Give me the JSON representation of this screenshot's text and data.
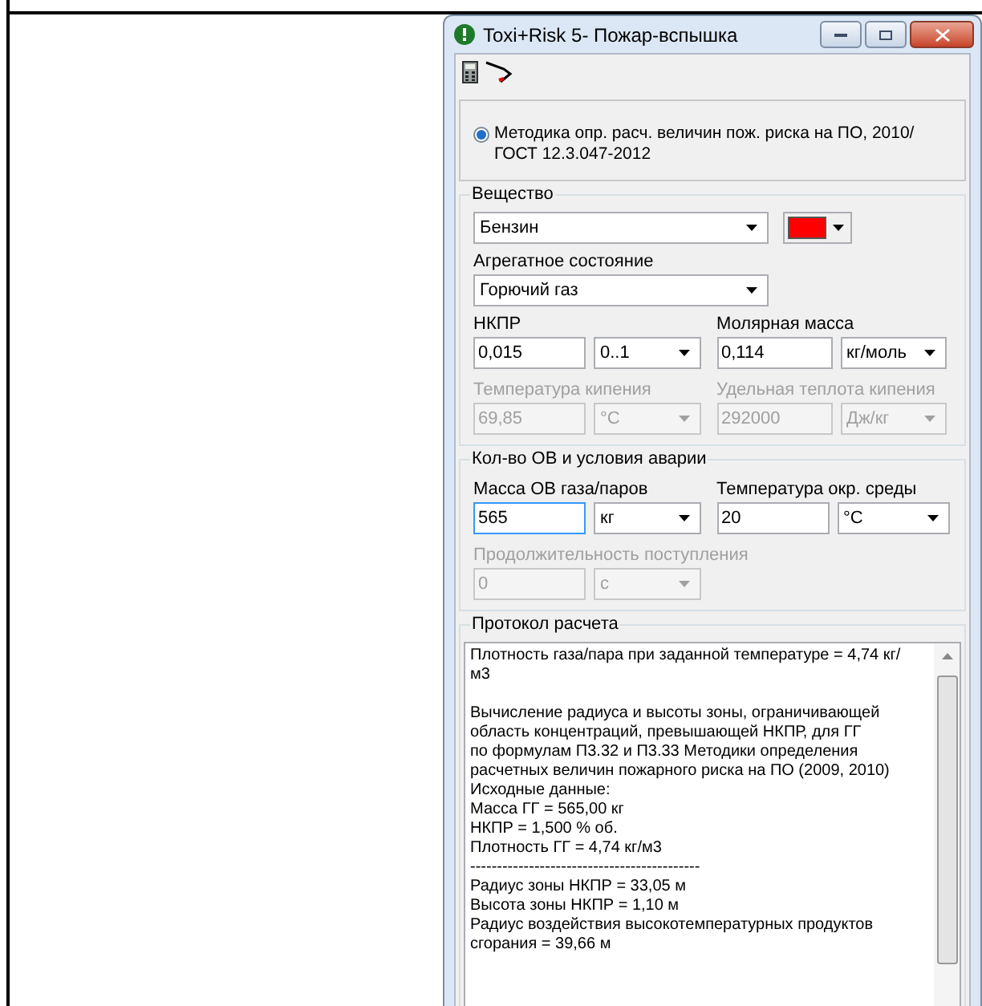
{
  "window": {
    "title": "Toxi+Risk 5- Пожар-вспышка"
  },
  "method": {
    "label": "Методика опр. расч. величин пож. риска на ПО, 2010/ ГОСТ 12.3.047-2012",
    "selected": true
  },
  "substance": {
    "title": "Вещество",
    "name": "Бензин",
    "color": "#ff0000",
    "state_label": "Агрегатное состояние",
    "state": "Горючий газ",
    "fields": [
      {
        "label": "НКПР",
        "value": "0,015",
        "unit": "0..1",
        "disabled": false
      },
      {
        "label": "Молярная масса",
        "value": "0,114",
        "unit": "кг/моль",
        "disabled": false
      },
      {
        "label": "Температура кипения",
        "value": "69,85",
        "unit": "°C",
        "disabled": true
      },
      {
        "label": "Удельная теплота кипения",
        "value": "292000",
        "unit": "Дж/кг",
        "disabled": true
      }
    ]
  },
  "accident": {
    "title": "Кол-во ОВ и условия аварии",
    "fields": [
      {
        "label": "Масса ОВ газа/паров",
        "value": "565",
        "unit": "кг",
        "disabled": false
      },
      {
        "label": "Температура окр. среды",
        "value": "20",
        "unit": "°C",
        "disabled": false
      },
      {
        "label": "Продолжительность поступления",
        "value": "0",
        "unit": "с",
        "disabled": true
      }
    ]
  },
  "protocol": {
    "title": "Протокол расчета",
    "blocks": [
      [
        "Плотность газа/пара при заданной температуре = 4,74 кг/м3"
      ],
      [
        "Вычисление радиуса и высоты зоны, ограничивающей",
        "область концентраций, превышающей НКПР, для ГГ",
        "по формулам П3.32 и П3.33 Методики определения",
        "расчетных величин пожарного риска на ПО (2009, 2010)",
        "Исходные данные:",
        "Масса ГГ = 565,00 кг",
        "НКПР = 1,500 % об.",
        "Плотность ГГ = 4,74 кг/м3",
        "-------------------------------------------",
        "Радиус зоны НКПР = 33,05 м",
        "Высота зоны НКПР = 1,10 м",
        "Радиус воздействия высокотемпературных продуктов сгорания = 39,66 м"
      ]
    ]
  }
}
